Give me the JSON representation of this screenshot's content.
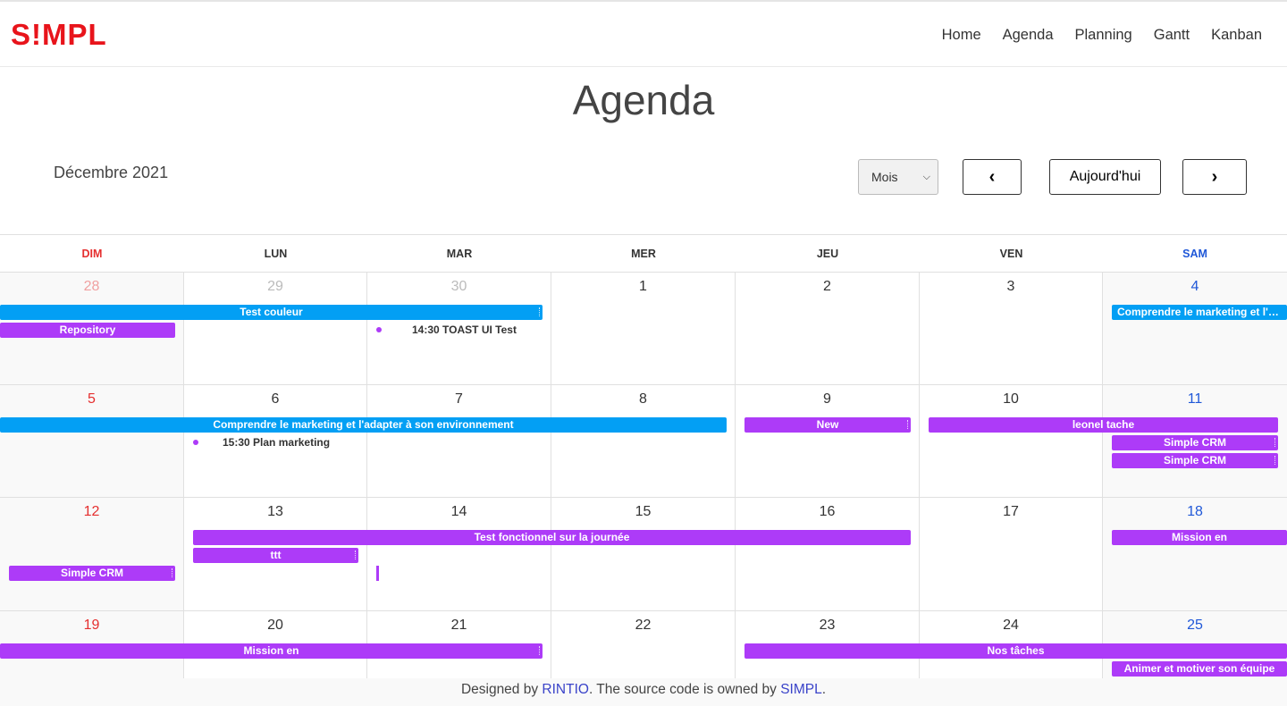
{
  "brand": {
    "logo_text": "S!MPL",
    "logo_color": "#e8141b"
  },
  "nav": {
    "items": [
      {
        "label": "Home"
      },
      {
        "label": "Agenda"
      },
      {
        "label": "Planning"
      },
      {
        "label": "Gantt"
      },
      {
        "label": "Kanban"
      }
    ]
  },
  "page": {
    "title": "Agenda",
    "month_label": "Décembre 2021"
  },
  "toolbar": {
    "view_select_value": "Mois",
    "prev_label": "‹",
    "today_label": "Aujourd'hui",
    "next_label": "›"
  },
  "calendar": {
    "weekdays": [
      "DIM",
      "LUN",
      "MAR",
      "MER",
      "JEU",
      "VEN",
      "SAM"
    ],
    "colors": {
      "sunday": "#e52f2f",
      "saturday": "#2058d8",
      "blue_event": "#039ff4",
      "purple_event": "#ad3bf8"
    },
    "weeks": [
      {
        "dates": [
          "28",
          "29",
          "30",
          "1",
          "2",
          "3",
          "4"
        ]
      },
      {
        "dates": [
          "5",
          "6",
          "7",
          "8",
          "9",
          "10",
          "11"
        ]
      },
      {
        "dates": [
          "12",
          "13",
          "14",
          "15",
          "16",
          "17",
          "18"
        ]
      },
      {
        "dates": [
          "19",
          "20",
          "21",
          "22",
          "23",
          "24",
          "25"
        ]
      }
    ],
    "events": {
      "w0_test_couleur": "Test couleur",
      "w0_repository": "Repository",
      "w0_toast_time": "14:30",
      "w0_toast_title": "TOAST UI Test",
      "w0_comprendre": "Comprendre le marketing et l'adapter à son environnement",
      "w1_comprendre": "Comprendre le marketing et l'adapter à son environnement",
      "w1_plan_time": "15:30",
      "w1_plan_title": "Plan marketing",
      "w1_new": "New",
      "w1_leonel": "leonel tache",
      "w1_crm1": "Simple CRM",
      "w1_crm2": "Simple CRM",
      "w2_test_fonctionnel": "Test fonctionnel sur la journée",
      "w2_ttt": "ttt",
      "w2_crm": "Simple CRM",
      "w2_mission": "Mission en",
      "w3_mission": "Mission en",
      "w3_nos_taches": "Nos tâches",
      "w3_animer": "Animer et motiver son équipe"
    }
  },
  "footer": {
    "prefix": "Designed by ",
    "author_link": "RINTIO",
    "middle": ". The source code is owned by ",
    "owner_link": "SIMPL",
    "suffix": "."
  }
}
